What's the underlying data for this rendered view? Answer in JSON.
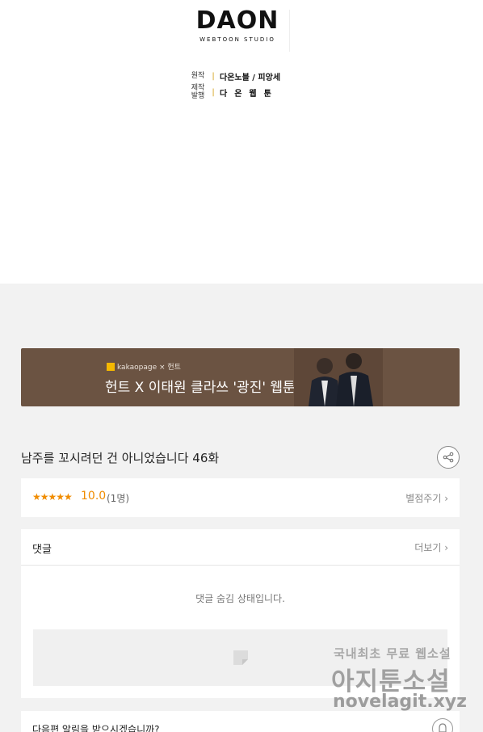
{
  "header": {
    "logo_main": "DAON",
    "logo_sub": "WEBTOON STUDIO",
    "credits": [
      {
        "label": "원작",
        "value": "다온노블 / 피앙세"
      },
      {
        "label": "제작\n발행",
        "value": "다온웹툰"
      }
    ]
  },
  "banner": {
    "brand": "kakaopage × 헌트",
    "text": "헌트 X 이태원 클라쓰 '광진' 웹툰"
  },
  "episode": {
    "title": "남주를 꼬시려던 건 아니었습니다 46화"
  },
  "rating": {
    "stars": "★★★★★",
    "score": "10.0",
    "count": "(1명)",
    "action": "별점주기 ›"
  },
  "comments": {
    "title": "댓글",
    "more": "더보기 ›",
    "hidden_message": "댓글 숨김 상태입니다."
  },
  "notify": {
    "text": "다음편 알림을 받으시겠습니까?"
  },
  "watermark": {
    "line1": "국내최초 무료 웹소설",
    "line2": "아지툰소설",
    "line3": "novelagit.xyz"
  }
}
